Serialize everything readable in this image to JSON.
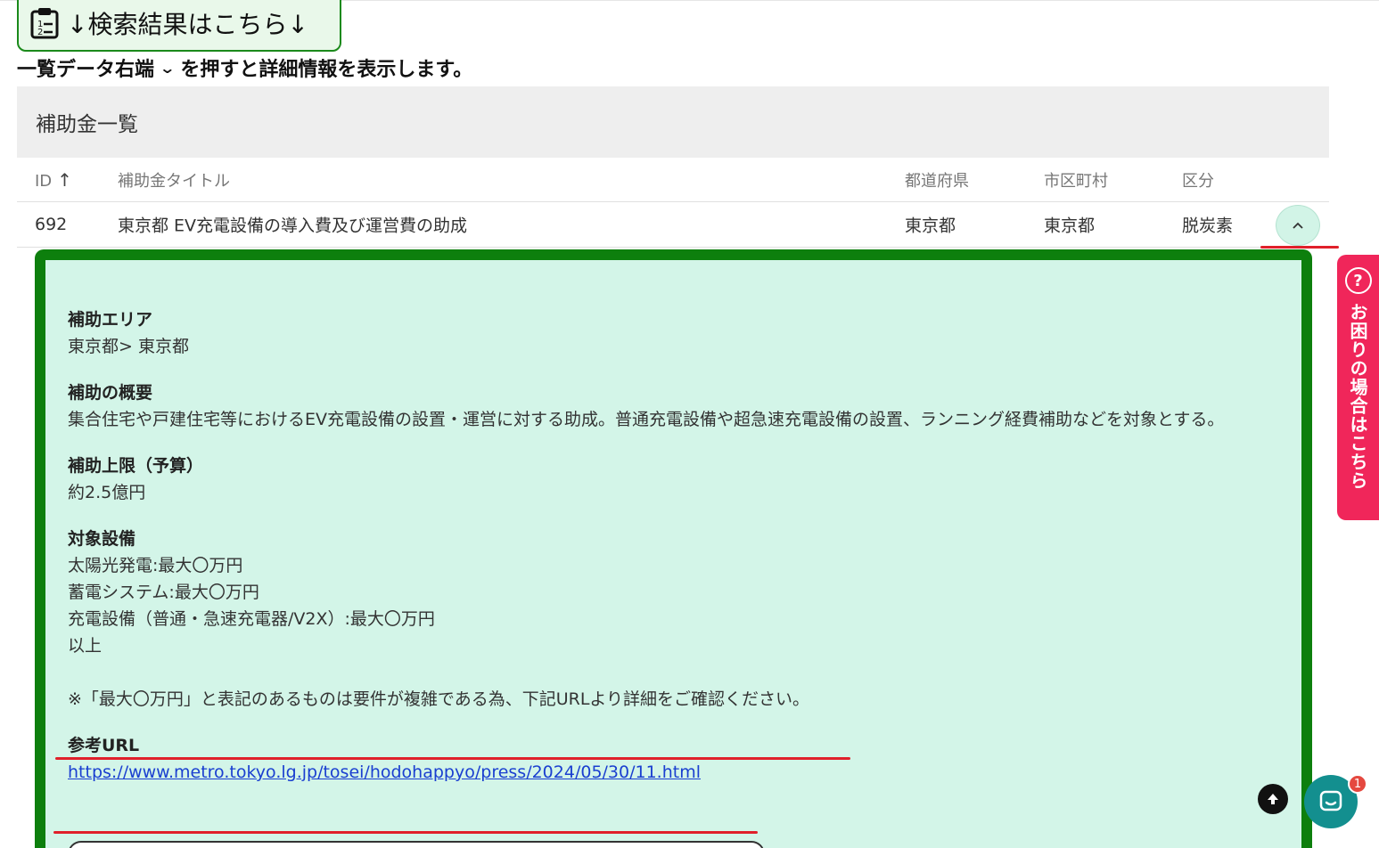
{
  "result_badge": {
    "text": "↓検索結果はこちら↓",
    "icon": "clipboard-icon"
  },
  "instruction": {
    "before": "一覧データ右端",
    "chevron": "⌄",
    "after": "を押すと詳細情報を表示します。"
  },
  "list": {
    "title": "補助金一覧",
    "columns": {
      "id": "ID",
      "title": "補助金タイトル",
      "prefecture": "都道府県",
      "city": "市区町村",
      "category": "区分"
    },
    "rows": [
      {
        "id": "692",
        "title": "東京都 EV充電設備の導入費及び運営費の助成",
        "prefecture": "東京都",
        "city": "東京都",
        "category": "脱炭素"
      }
    ]
  },
  "detail": {
    "area_label": "補助エリア",
    "area_value": "東京都> 東京都",
    "summary_label": "補助の概要",
    "summary_value": "集合住宅や戸建住宅等におけるEV充電設備の設置・運営に対する助成。普通充電設備や超急速充電設備の設置、ランニング経費補助などを対象とする。",
    "limit_label": "補助上限（予算）",
    "limit_value": "約2.5億円",
    "equipment_label": "対象設備",
    "equipment_items": [
      "太陽光発電:最大〇万円",
      "蓄電システム:最大〇万円",
      "充電設備（普通・急速充電器/V2X）:最大〇万円",
      "以上"
    ],
    "note": "※「最大〇万円」と表記のあるものは要件が複雑である為、下記URLより詳細をご確認ください。",
    "url_label": "参考URL",
    "url": "https://www.metro.tokyo.lg.jp/tosei/hodohappyo/press/2024/05/30/11.html"
  },
  "help_tab": {
    "text": "お困りの場合はこちら",
    "icon": "question-icon"
  },
  "chat": {
    "badge": "1"
  },
  "colors": {
    "panel_border": "#0d7f0d",
    "panel_bg": "#d3f5e8",
    "help_tab": "#f0265a",
    "chat": "#138f8f",
    "underline": "#e0202a"
  }
}
